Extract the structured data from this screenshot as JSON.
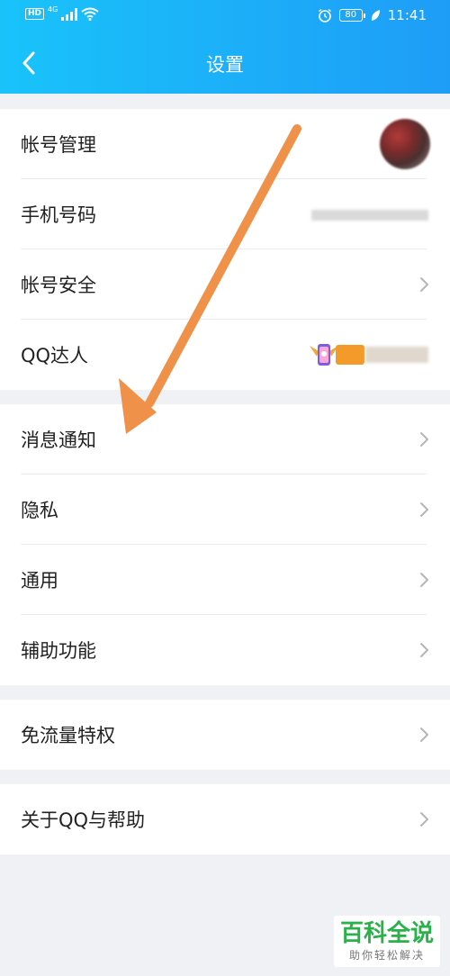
{
  "status_bar": {
    "left_badge": "HD",
    "network": "4G",
    "battery": "80",
    "time": "11:41"
  },
  "header": {
    "title": "设置"
  },
  "groups": [
    {
      "items": [
        {
          "label": "帐号管理"
        },
        {
          "label": "手机号码"
        },
        {
          "label": "帐号安全"
        },
        {
          "label": "QQ达人"
        }
      ]
    },
    {
      "items": [
        {
          "label": "消息通知"
        },
        {
          "label": "隐私"
        },
        {
          "label": "通用"
        },
        {
          "label": "辅助功能"
        }
      ]
    },
    {
      "items": [
        {
          "label": "免流量特权"
        }
      ]
    },
    {
      "items": [
        {
          "label": "关于QQ与帮助"
        }
      ]
    }
  ],
  "watermark": {
    "main": "百科全说",
    "sub": "助你轻松解决"
  },
  "colors": {
    "header_start": "#19c3fa",
    "header_end": "#1e9df7",
    "page_bg": "#eff1f5",
    "arrow": "#f0914a",
    "watermark_green": "#2ab14a"
  }
}
